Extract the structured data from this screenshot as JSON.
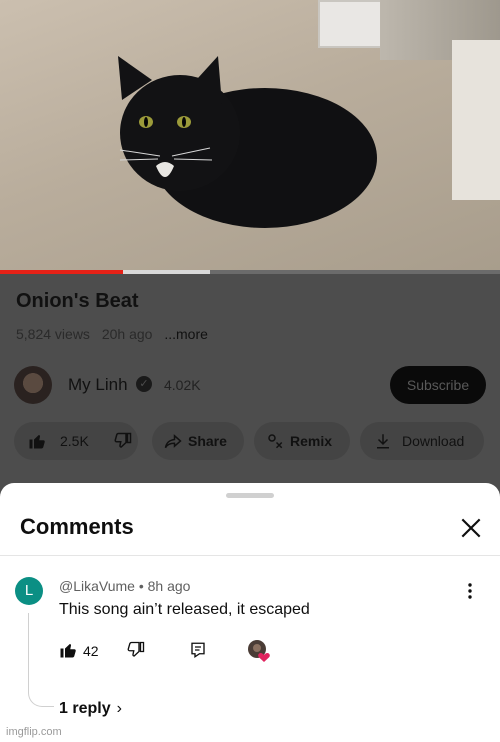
{
  "video": {
    "progress_fraction": 0.245,
    "buffered_fraction": 0.42
  },
  "details": {
    "title": "Onion's Beat",
    "views": "5,824 views",
    "age": "20h ago",
    "more_label": "...more"
  },
  "channel": {
    "name": "My Linh",
    "subscribers": "4.02K",
    "subscribe_label": "Subscribe"
  },
  "actions": {
    "likes": "2.5K",
    "share_label": "Share",
    "remix_label": "Remix",
    "download_label": "Download"
  },
  "comments": {
    "title": "Comments",
    "items": [
      {
        "avatar_letter": "L",
        "avatar_color": "#0b8f84",
        "author": "@LikaVume",
        "time": "8h ago",
        "text": "This song ain’t released, it escaped",
        "likes": "42",
        "replies_label": "1 reply"
      }
    ]
  },
  "watermark": "imgflip.com",
  "colors": {
    "progress": "#e62117",
    "heart": "#e0245e"
  },
  "icons": [
    "thumbs-up-icon",
    "thumbs-down-icon",
    "share-icon",
    "remix-icon",
    "download-icon",
    "close-icon",
    "more-vert-icon",
    "reply-icon",
    "heart-icon",
    "chevron-right-icon",
    "verified-icon"
  ]
}
